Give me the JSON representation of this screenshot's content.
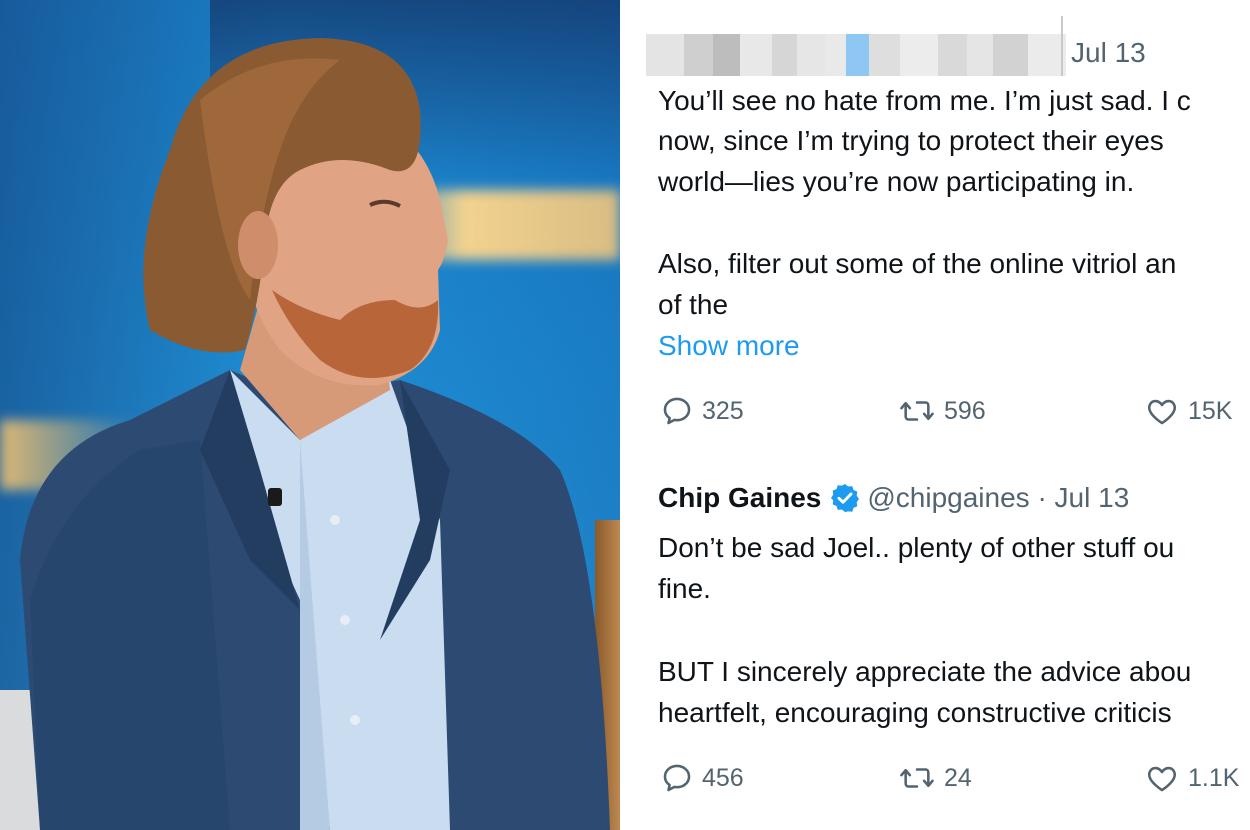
{
  "tweet1": {
    "date": "Jul 13",
    "lines": [
      "You’ll see no hate from me. I’m just sad. I c",
      "now, since I’m trying to protect their eyes",
      "world—lies you’re now participating in.",
      "Also, filter out some of the online vitriol an",
      "of the"
    ],
    "show_more": "Show more",
    "replies": "325",
    "retweets": "596",
    "likes": "15K"
  },
  "tweet2": {
    "author_name": "Chip Gaines",
    "handle_date": "@chipgaines · Jul 13",
    "lines": [
      "Don’t be sad Joel.. plenty of other stuff ou",
      "fine.",
      "BUT I sincerely appreciate the advice abou",
      "heartfelt, encouraging constructive criticis"
    ],
    "replies": "456",
    "retweets": "24",
    "likes": "1.1K"
  },
  "colors": {
    "text": "#0f1419",
    "secondary": "#536471",
    "link": "#1d9bf0",
    "verified": "#1d9bf0"
  }
}
